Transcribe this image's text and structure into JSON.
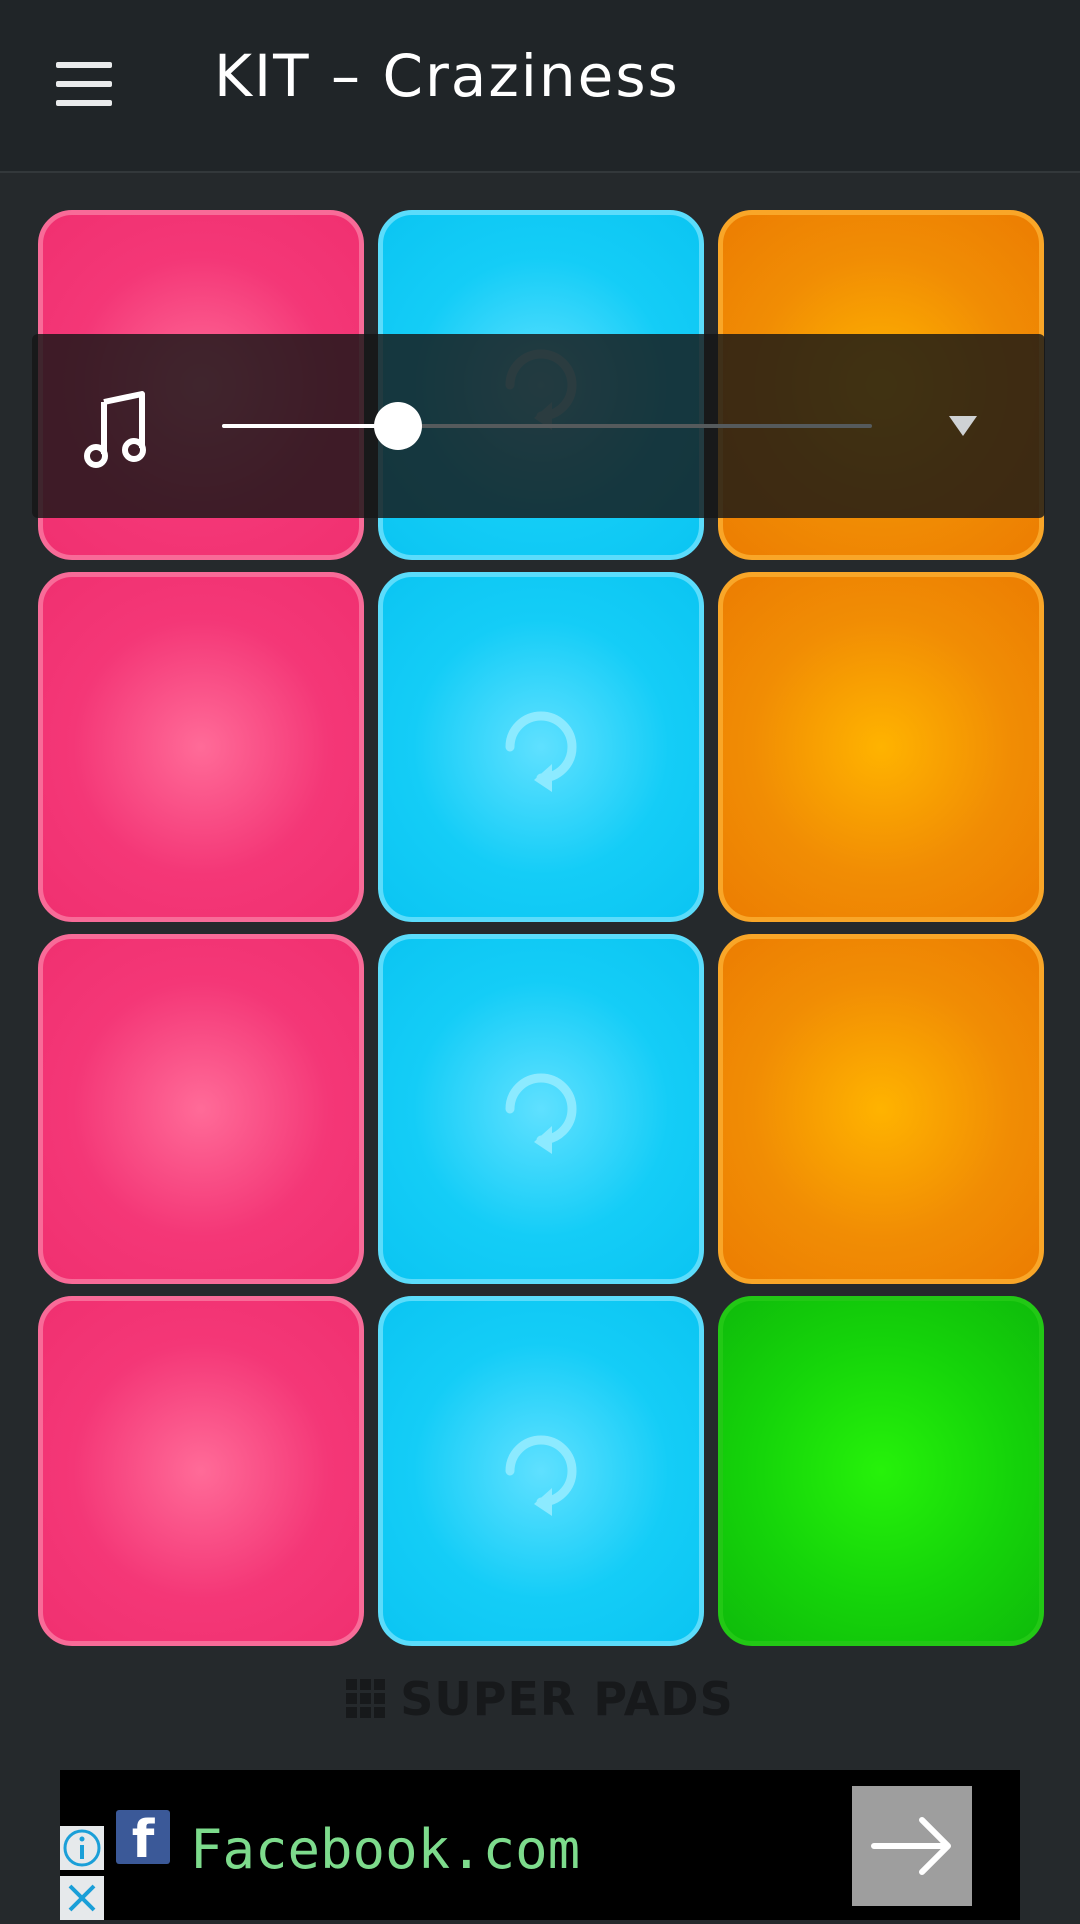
{
  "app": {
    "title": "KIT – Craziness",
    "menu_icon": "hamburger-icon",
    "brand_text": "SUPER PADS",
    "brand_icon": "grid-icon"
  },
  "pads": [
    {
      "row": 1,
      "col": 1,
      "color": "pink",
      "loop": false
    },
    {
      "row": 1,
      "col": 2,
      "color": "blue",
      "loop": true
    },
    {
      "row": 1,
      "col": 3,
      "color": "orange",
      "loop": false
    },
    {
      "row": 2,
      "col": 1,
      "color": "pink",
      "loop": false
    },
    {
      "row": 2,
      "col": 2,
      "color": "blue",
      "loop": true
    },
    {
      "row": 2,
      "col": 3,
      "color": "orange",
      "loop": false
    },
    {
      "row": 3,
      "col": 1,
      "color": "pink",
      "loop": false
    },
    {
      "row": 3,
      "col": 2,
      "color": "blue",
      "loop": true
    },
    {
      "row": 3,
      "col": 3,
      "color": "orange",
      "loop": false
    },
    {
      "row": 4,
      "col": 1,
      "color": "pink",
      "loop": false
    },
    {
      "row": 4,
      "col": 2,
      "color": "blue",
      "loop": true
    },
    {
      "row": 4,
      "col": 3,
      "color": "green",
      "loop": false
    }
  ],
  "colors": {
    "pink": "#f43777",
    "blue": "#14cdf7",
    "orange": "#f18d04",
    "green": "#15d40a"
  },
  "volume": {
    "icon": "music-note-icon",
    "level_fraction": 0.27,
    "dropdown_icon": "triangle-down-icon"
  },
  "ad": {
    "logo_icon": "facebook-f-icon",
    "logo_text": "f",
    "text": "Facebook.com",
    "arrow_icon": "arrow-right-icon",
    "info_icon": "info-icon",
    "close_icon": "close-icon"
  }
}
